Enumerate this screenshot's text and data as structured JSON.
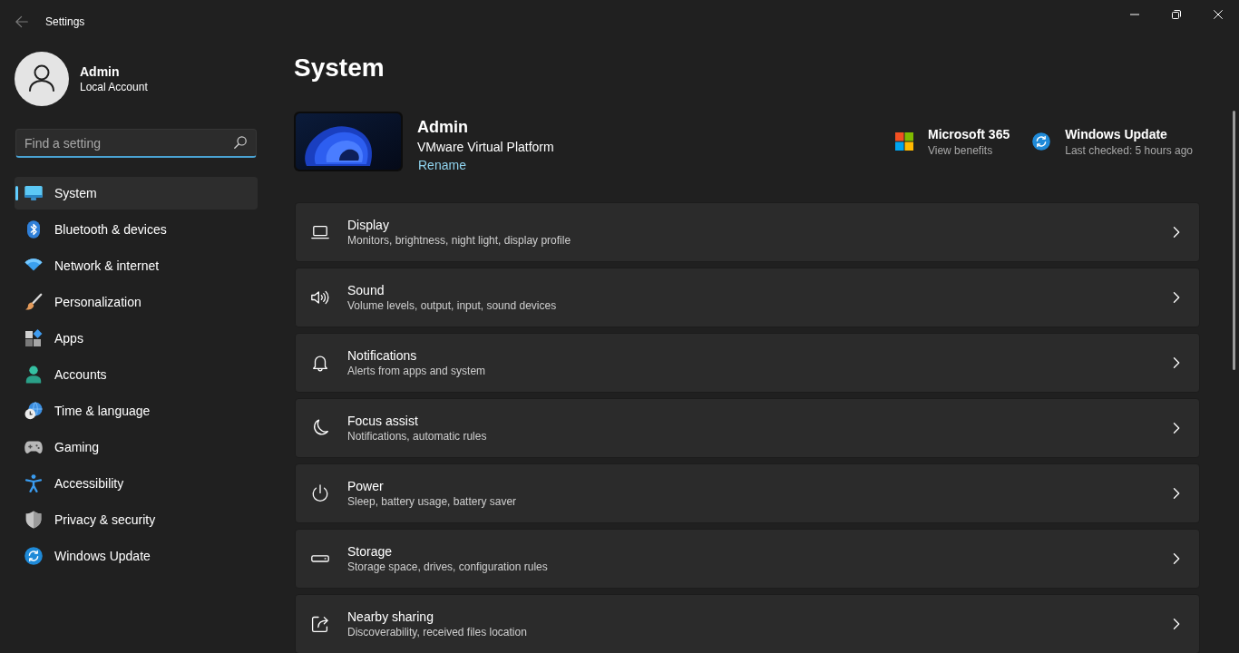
{
  "window": {
    "title": "Settings"
  },
  "profile": {
    "name": "Admin",
    "account_type": "Local Account"
  },
  "search": {
    "placeholder": "Find a setting"
  },
  "nav": {
    "items": [
      {
        "label": "System",
        "selected": true
      },
      {
        "label": "Bluetooth & devices",
        "selected": false
      },
      {
        "label": "Network & internet",
        "selected": false
      },
      {
        "label": "Personalization",
        "selected": false
      },
      {
        "label": "Apps",
        "selected": false
      },
      {
        "label": "Accounts",
        "selected": false
      },
      {
        "label": "Time & language",
        "selected": false
      },
      {
        "label": "Gaming",
        "selected": false
      },
      {
        "label": "Accessibility",
        "selected": false
      },
      {
        "label": "Privacy & security",
        "selected": false
      },
      {
        "label": "Windows Update",
        "selected": false
      }
    ]
  },
  "page": {
    "title": "System"
  },
  "device": {
    "name": "Admin",
    "model": "VMware Virtual Platform",
    "rename_link": "Rename"
  },
  "quick_links": [
    {
      "title": "Microsoft 365",
      "subtitle": "View benefits"
    },
    {
      "title": "Windows Update",
      "subtitle": "Last checked: 5 hours ago"
    }
  ],
  "settings": [
    {
      "title": "Display",
      "subtitle": "Monitors, brightness, night light, display profile"
    },
    {
      "title": "Sound",
      "subtitle": "Volume levels, output, input, sound devices"
    },
    {
      "title": "Notifications",
      "subtitle": "Alerts from apps and system"
    },
    {
      "title": "Focus assist",
      "subtitle": "Notifications, automatic rules"
    },
    {
      "title": "Power",
      "subtitle": "Sleep, battery usage, battery saver"
    },
    {
      "title": "Storage",
      "subtitle": "Storage space, drives, configuration rules"
    },
    {
      "title": "Nearby sharing",
      "subtitle": "Discoverability, received files location"
    }
  ]
}
